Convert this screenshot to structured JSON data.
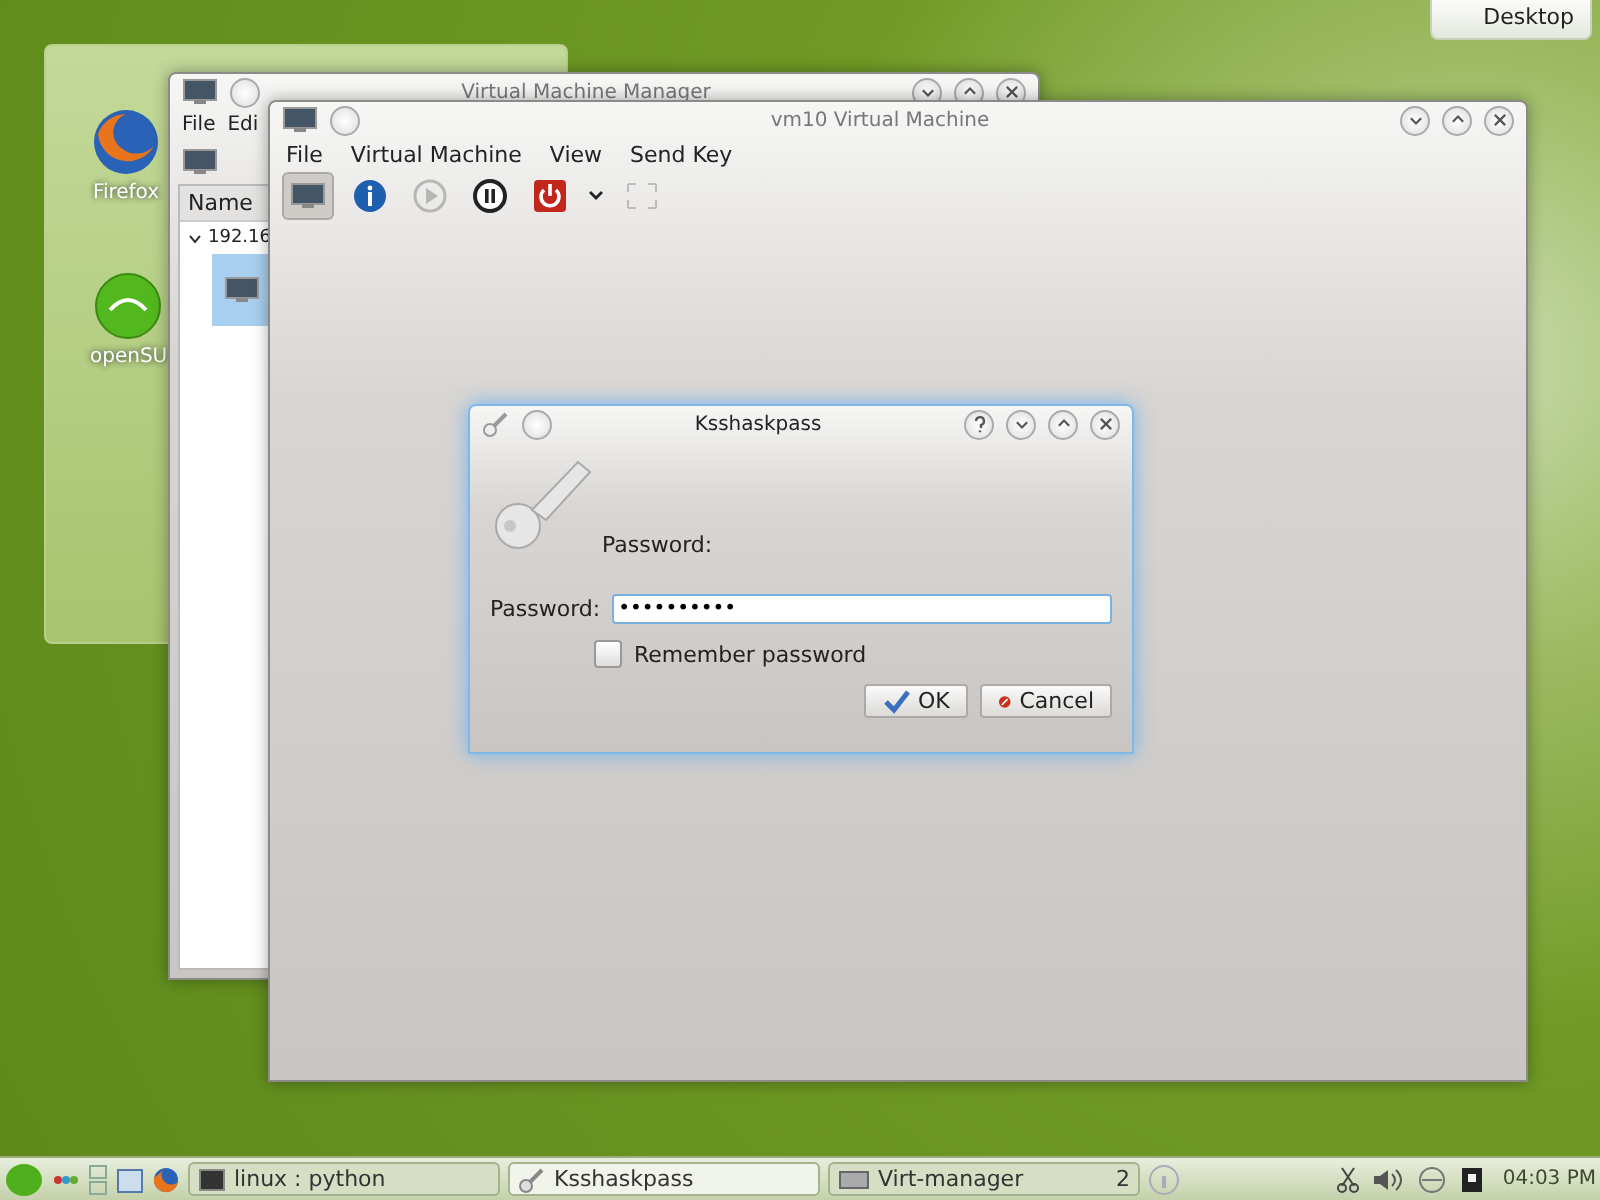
{
  "desktop_button": {
    "label": "Desktop"
  },
  "folder_view": {
    "icons": [
      {
        "label": "Firefox",
        "kind": "firefox"
      },
      {
        "label": "openSU",
        "kind": "suse"
      }
    ]
  },
  "manager_window": {
    "title": "Virtual Machine Manager",
    "menu": [
      "File",
      "Edi"
    ],
    "column": "Name",
    "host": "192.16",
    "vm_selected": true
  },
  "vm_window": {
    "title": "vm10 Virtual Machine",
    "menu": [
      "File",
      "Virtual Machine",
      "View",
      "Send Key"
    ],
    "toolbar": [
      {
        "kind": "screen",
        "pressed": true,
        "disabled": false
      },
      {
        "kind": "info",
        "pressed": false,
        "disabled": false
      },
      {
        "kind": "play",
        "pressed": false,
        "disabled": true
      },
      {
        "kind": "pause",
        "pressed": false,
        "disabled": false
      },
      {
        "kind": "power",
        "pressed": false,
        "disabled": false
      },
      {
        "kind": "caret",
        "pressed": false,
        "disabled": false
      },
      {
        "kind": "fullscreen",
        "pressed": false,
        "disabled": true
      }
    ]
  },
  "dialog": {
    "title": "Ksshaskpass",
    "prompt": "Password:",
    "field_label": "Password:",
    "field_value": "••••••••••",
    "remember": {
      "label": "Remember password",
      "checked": false
    },
    "buttons": [
      {
        "label": "OK",
        "kind": "ok"
      },
      {
        "label": "Cancel",
        "kind": "cancel"
      }
    ]
  },
  "taskbar": {
    "tasks": [
      {
        "label": "linux : python",
        "kind": "terminal",
        "selected": false
      },
      {
        "label": "Ksshaskpass",
        "kind": "key",
        "selected": true
      },
      {
        "label": "Virt-manager",
        "kind": "vm",
        "selected": false,
        "count": "2"
      }
    ],
    "clock": "04:03 PM"
  }
}
